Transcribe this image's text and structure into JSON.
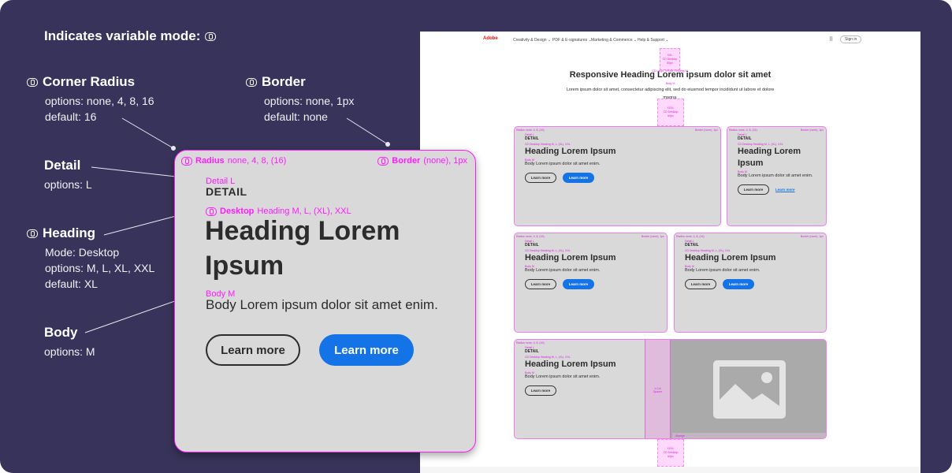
{
  "legend": {
    "title": "Indicates variable mode:"
  },
  "annotations": {
    "corner_radius": {
      "title": "Corner Radius",
      "options": "options: none, 4, 8, 16",
      "default": "default: 16"
    },
    "border": {
      "title": "Border",
      "options": "options: none, 1px",
      "default": "default: none"
    },
    "detail": {
      "title": "Detail",
      "options": "options: L"
    },
    "heading": {
      "title": "Heading",
      "mode": "Mode: Desktop",
      "options": "options: M, L, XL, XXL",
      "default": "default: XL"
    },
    "body": {
      "title": "Body",
      "options": "options: M"
    }
  },
  "card": {
    "radius_label": "Radius",
    "radius_values": "none, 4, 8, (16)",
    "border_label": "Border",
    "border_values": "(none), 1px",
    "detail_label": "Detail L",
    "detail": "DETAIL",
    "heading_mode": "Desktop",
    "heading_label": "Heading M, L, (XL), XXL",
    "heading": "Heading Lorem Ipsum",
    "body_label": "Body M",
    "body": "Body Lorem ipsum dolor sit amet enim.",
    "button_outline": "Learn more",
    "button_primary": "Learn more"
  },
  "page": {
    "nav": {
      "logo": "Adobe",
      "items": [
        "Creativity & Design ⌄",
        "PDF & E-signatures ⌄",
        "Marketing & Commerce ⌄",
        "Help & Support ⌄"
      ],
      "sign_in": "Sign in"
    },
    "spacer_top": "XXL\nCD Desktop\n80px",
    "heading_label": "CD Large Tertiale Heading XL",
    "heading": "Responsive Heading Lorem ipsum dolor sit amet",
    "body_label": "Body M",
    "body": "Lorem ipsum dolor sit amet, consectetur adipiscing elit, sed do eiusmod tempor incididunt ut labore et dolore magna.",
    "spacer_mid": "XXXL\nCD Desktop\n64px",
    "spacer_bottom": "XXXL\nCD Desktop\n64px",
    "col_spacer": "1-Col\nSpacer",
    "image_label": "Aimage",
    "link": "Learn more",
    "mini_radius": "Radius none, 4, 8, (16)",
    "mini_border": "Border (none), 1px",
    "mini_heading_label": "CD Desktop Heading M, L, (XL), XXL"
  },
  "colors": {
    "background": "#38335a",
    "magenta": "#ff1aff",
    "primary": "#1473e6",
    "card": "#d9d9d9"
  }
}
